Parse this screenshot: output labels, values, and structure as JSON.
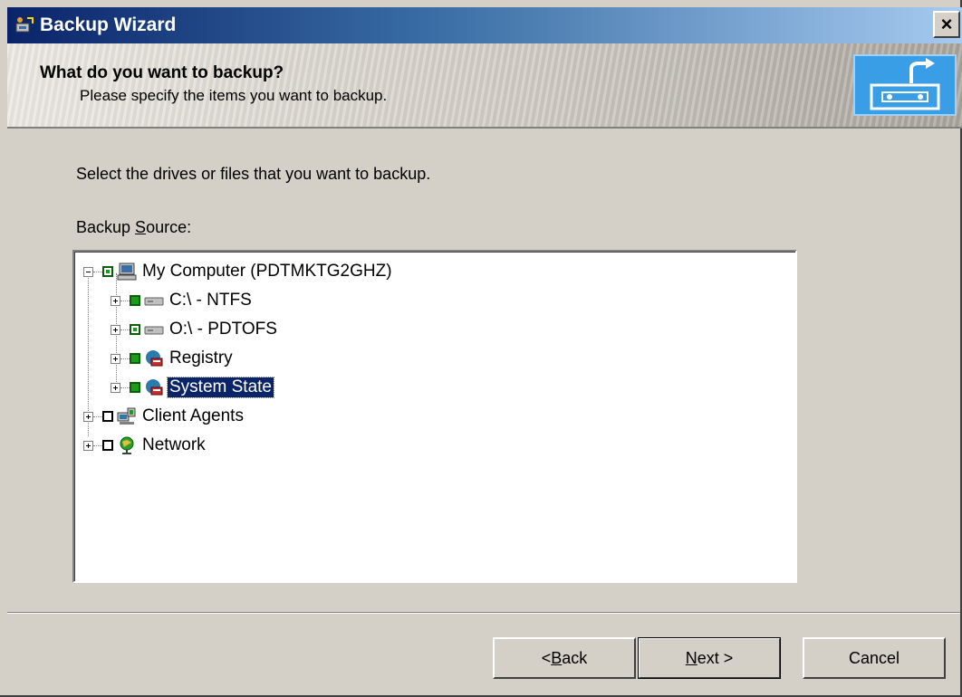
{
  "window": {
    "title": "Backup Wizard",
    "close_label": "×"
  },
  "header": {
    "title": "What do you want to backup?",
    "subtitle": "Please specify the items you want to backup."
  },
  "body": {
    "instruction": "Select the drives or files that you want to backup.",
    "source_label_prefix": "Backup ",
    "source_label_accel": "S",
    "source_label_rest": "ource:"
  },
  "tree": {
    "items": [
      {
        "label": "My Computer (PDTMKTG2GHZ)",
        "icon": "computer-icon",
        "check": "partial"
      },
      {
        "label": "C:\\ - NTFS",
        "icon": "drive-icon",
        "check": "full"
      },
      {
        "label": "O:\\ - PDTOFS",
        "icon": "drive-icon",
        "check": "partial"
      },
      {
        "label": "Registry",
        "icon": "registry-icon",
        "check": "full"
      },
      {
        "label": "System State",
        "icon": "system-state-icon",
        "check": "full",
        "selected": true
      },
      {
        "label": "Client Agents",
        "icon": "client-agents-icon",
        "check": "empty"
      },
      {
        "label": "Network",
        "icon": "network-icon",
        "check": "empty"
      }
    ]
  },
  "buttons": {
    "back_accel": "B",
    "back_rest": "ack",
    "back_prefix": "< ",
    "next_accel": "N",
    "next_rest": "ext >",
    "cancel": "Cancel"
  },
  "colors": {
    "title_gradient_start": "#0a246a",
    "selection": "#0a246a",
    "check_green": "#1a9e1a",
    "dialog_face": "#d4d0c8"
  }
}
